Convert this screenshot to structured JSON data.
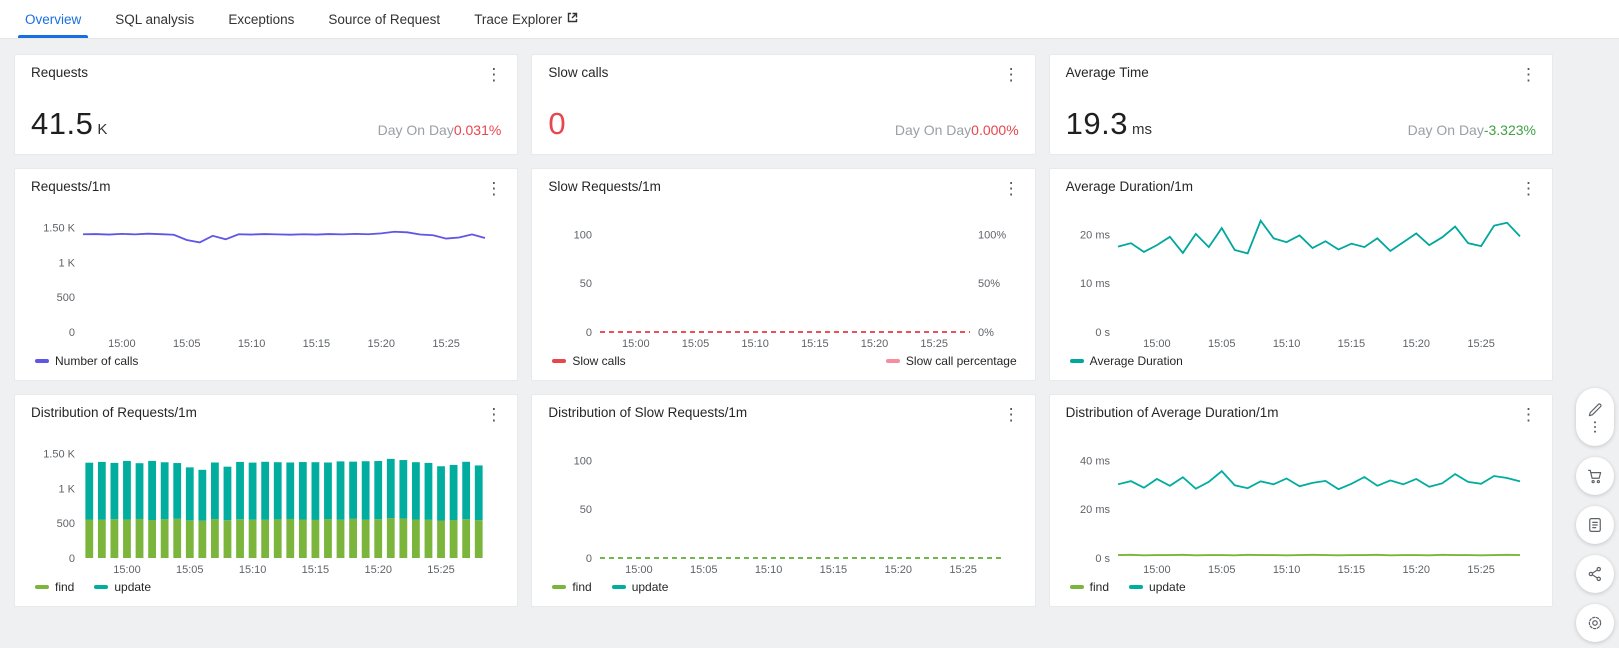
{
  "icons": {
    "kebab": "⋮"
  },
  "tabs": {
    "items": [
      {
        "label": "Overview",
        "active": true
      },
      {
        "label": "SQL analysis",
        "active": false
      },
      {
        "label": "Exceptions",
        "active": false
      },
      {
        "label": "Source of Request",
        "active": false
      },
      {
        "label": "Trace Explorer",
        "active": false,
        "external_icon": true
      }
    ]
  },
  "kpis": [
    {
      "title": "Requests",
      "value": "41.5",
      "unit": "K",
      "value_color": "#1f1f1f",
      "dod_label": "Day On Day",
      "dod_value": "0.031%",
      "dod_color": "#e8454d"
    },
    {
      "title": "Slow calls",
      "value": "0",
      "unit": "",
      "value_color": "#e8454d",
      "dod_label": "Day On Day",
      "dod_value": "0.000%",
      "dod_color": "#e8454d"
    },
    {
      "title": "Average Time",
      "value": "19.3",
      "unit": "ms",
      "value_color": "#1f1f1f",
      "dod_label": "Day On Day",
      "dod_value": "-3.323%",
      "dod_color": "#3fa045"
    }
  ],
  "chart_data": [
    {
      "title": "Requests/1m",
      "type": "line",
      "ylim": [
        0,
        1750
      ],
      "y_ticks": [
        {
          "value": 1500,
          "label": "1.50 K"
        },
        {
          "value": 1000,
          "label": "1 K"
        },
        {
          "value": 500,
          "label": "500"
        },
        {
          "value": 0,
          "label": "0"
        }
      ],
      "x_tick_labels": [
        "15:00",
        "15:05",
        "15:10",
        "15:15",
        "15:20",
        "15:25"
      ],
      "x_tick_indexes": [
        3,
        8,
        13,
        18,
        23,
        28
      ],
      "series": [
        {
          "name": "Number of calls",
          "color": "#5f55e6",
          "dashed": false,
          "values": [
            1402,
            1405,
            1398,
            1408,
            1400,
            1410,
            1403,
            1395,
            1320,
            1285,
            1380,
            1330,
            1402,
            1398,
            1405,
            1400,
            1396,
            1402,
            1398,
            1405,
            1400,
            1408,
            1402,
            1415,
            1438,
            1430,
            1398,
            1388,
            1340,
            1355,
            1400,
            1348
          ]
        }
      ],
      "legend_split": false
    },
    {
      "title": "Slow Requests/1m",
      "type": "line",
      "ylim": [
        0,
        125
      ],
      "y_ticks": [
        {
          "value": 100,
          "label": "100"
        },
        {
          "value": 50,
          "label": "50"
        },
        {
          "value": 0,
          "label": "0"
        }
      ],
      "right_y_ticks": [
        {
          "value": 100,
          "label": "100%"
        },
        {
          "value": 50,
          "label": "50%"
        },
        {
          "value": 0,
          "label": "0%"
        }
      ],
      "x_tick_labels": [
        "15:00",
        "15:05",
        "15:10",
        "15:15",
        "15:20",
        "15:25"
      ],
      "x_tick_indexes": [
        3,
        8,
        13,
        18,
        23,
        28
      ],
      "series": [
        {
          "name": "Slow calls",
          "color": "#e8454d",
          "dashed": true,
          "values": [
            0,
            0,
            0,
            0,
            0,
            0,
            0,
            0,
            0,
            0,
            0,
            0,
            0,
            0,
            0,
            0,
            0,
            0,
            0,
            0,
            0,
            0,
            0,
            0,
            0,
            0,
            0,
            0,
            0,
            0,
            0,
            0
          ]
        },
        {
          "name": "Slow call percentage",
          "color": "#f78c9e",
          "dashed": true,
          "values": [
            0,
            0,
            0,
            0,
            0,
            0,
            0,
            0,
            0,
            0,
            0,
            0,
            0,
            0,
            0,
            0,
            0,
            0,
            0,
            0,
            0,
            0,
            0,
            0,
            0,
            0,
            0,
            0,
            0,
            0,
            0,
            0
          ]
        }
      ],
      "legend_split": true
    },
    {
      "title": "Average Duration/1m",
      "type": "line",
      "ylim": [
        0,
        25
      ],
      "y_ticks": [
        {
          "value": 20,
          "label": "20 ms"
        },
        {
          "value": 10,
          "label": "10 ms"
        },
        {
          "value": 0,
          "label": "0 s"
        }
      ],
      "x_tick_labels": [
        "15:00",
        "15:05",
        "15:10",
        "15:15",
        "15:20",
        "15:25"
      ],
      "x_tick_indexes": [
        3,
        8,
        13,
        18,
        23,
        28
      ],
      "series": [
        {
          "name": "Average Duration",
          "color": "#00a79d",
          "dashed": false,
          "values": [
            17.5,
            18.2,
            16.4,
            17.8,
            19.5,
            16.2,
            20.1,
            17.4,
            21.3,
            16.8,
            16.1,
            22.8,
            19.2,
            18.4,
            19.8,
            17.2,
            18.6,
            16.9,
            18.1,
            17.4,
            19.2,
            16.6,
            18.4,
            20.2,
            17.8,
            19.4,
            21.6,
            18.2,
            17.6,
            21.8,
            22.4,
            19.6
          ]
        }
      ],
      "legend_split": false
    },
    {
      "title": "Distribution of Requests/1m",
      "type": "stacked_bar",
      "ylim": [
        0,
        1750
      ],
      "y_ticks": [
        {
          "value": 1500,
          "label": "1.50 K"
        },
        {
          "value": 1000,
          "label": "1 K"
        },
        {
          "value": 500,
          "label": "500"
        },
        {
          "value": 0,
          "label": "0"
        }
      ],
      "x_tick_labels": [
        "15:00",
        "15:05",
        "15:10",
        "15:15",
        "15:20",
        "15:25"
      ],
      "x_tick_indexes": [
        3,
        8,
        13,
        18,
        23,
        28
      ],
      "series": [
        {
          "name": "find",
          "color": "#7bb53c",
          "dashed": false,
          "values": [
            552,
            548,
            556,
            550,
            560,
            545,
            555,
            562,
            540,
            535,
            558,
            542,
            556,
            550,
            548,
            554,
            560,
            552,
            546,
            558,
            550,
            562,
            548,
            556,
            570,
            565,
            552,
            548,
            538,
            545,
            556,
            542
          ]
        },
        {
          "name": "update",
          "color": "#00ad9f",
          "dashed": false,
          "values": [
            815,
            830,
            808,
            842,
            800,
            848,
            818,
            800,
            760,
            730,
            812,
            768,
            822,
            818,
            832,
            820,
            810,
            824,
            828,
            812,
            836,
            820,
            840,
            835,
            852,
            840,
            822,
            816,
            778,
            790,
            824,
            786
          ]
        }
      ],
      "legend_split": false
    },
    {
      "title": "Distribution of Slow Requests/1m",
      "type": "line",
      "ylim": [
        0,
        125
      ],
      "y_ticks": [
        {
          "value": 100,
          "label": "100"
        },
        {
          "value": 50,
          "label": "50"
        },
        {
          "value": 0,
          "label": "0"
        }
      ],
      "x_tick_labels": [
        "15:00",
        "15:05",
        "15:10",
        "15:15",
        "15:20",
        "15:25"
      ],
      "x_tick_indexes": [
        3,
        8,
        13,
        18,
        23,
        28
      ],
      "series": [
        {
          "name": "find",
          "color": "#7bb53c",
          "dashed": true,
          "values": [
            0,
            0,
            0,
            0,
            0,
            0,
            0,
            0,
            0,
            0,
            0,
            0,
            0,
            0,
            0,
            0,
            0,
            0,
            0,
            0,
            0,
            0,
            0,
            0,
            0,
            0,
            0,
            0,
            0,
            0,
            0,
            0
          ]
        },
        {
          "name": "update",
          "color": "#00ad9f",
          "dashed": true,
          "values": [
            0,
            0,
            0,
            0,
            0,
            0,
            0,
            0,
            0,
            0,
            0,
            0,
            0,
            0,
            0,
            0,
            0,
            0,
            0,
            0,
            0,
            0,
            0,
            0,
            0,
            0,
            0,
            0,
            0,
            0,
            0,
            0
          ]
        }
      ],
      "legend_split": false
    },
    {
      "title": "Distribution of Average Duration/1m",
      "type": "line",
      "ylim": [
        0,
        50
      ],
      "y_ticks": [
        {
          "value": 40,
          "label": "40 ms"
        },
        {
          "value": 20,
          "label": "20 ms"
        },
        {
          "value": 0,
          "label": "0 s"
        }
      ],
      "x_tick_labels": [
        "15:00",
        "15:05",
        "15:10",
        "15:15",
        "15:20",
        "15:25"
      ],
      "x_tick_indexes": [
        3,
        8,
        13,
        18,
        23,
        28
      ],
      "series": [
        {
          "name": "find",
          "color": "#7bb53c",
          "dashed": false,
          "values": [
            1.2,
            1.3,
            1.1,
            1.2,
            1.2,
            1.3,
            1.1,
            1.2,
            1.2,
            1.1,
            1.3,
            1.2,
            1.2,
            1.1,
            1.2,
            1.3,
            1.2,
            1.1,
            1.2,
            1.2,
            1.3,
            1.1,
            1.2,
            1.2,
            1.1,
            1.3,
            1.2,
            1.2,
            1.1,
            1.2,
            1.3,
            1.2
          ]
        },
        {
          "name": "update",
          "color": "#00ad9f",
          "dashed": false,
          "values": [
            30.2,
            31.5,
            28.8,
            32.4,
            29.6,
            33.1,
            28.4,
            31.2,
            35.6,
            29.8,
            28.6,
            31.4,
            30.2,
            32.6,
            29.4,
            30.8,
            31.6,
            28.2,
            30.4,
            33.2,
            29.6,
            31.8,
            30.2,
            32.4,
            29.2,
            30.6,
            34.4,
            31.2,
            30.4,
            33.6,
            32.8,
            31.4
          ]
        }
      ],
      "legend_split": false
    }
  ],
  "side_toolbar": {
    "icons": [
      "edit-icon",
      "more-icon",
      "cart-icon",
      "survey-icon",
      "share-icon",
      "settings-icon"
    ]
  }
}
